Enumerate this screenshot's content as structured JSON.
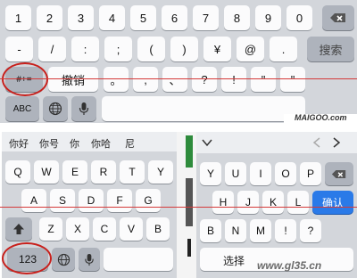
{
  "top": {
    "row1": [
      "1",
      "2",
      "3",
      "4",
      "5",
      "6",
      "7",
      "8",
      "9",
      "0"
    ],
    "row2": [
      "-",
      "/",
      ":",
      ";",
      "(",
      ")",
      "¥",
      "@",
      "."
    ],
    "search": "搜索",
    "row3_switch": "#+=",
    "undo": "撤销",
    "row3": [
      "。",
      ",",
      "、",
      "?",
      "!",
      "\"",
      "\""
    ],
    "abc": "ABC",
    "watermark": "MAIGOO.com"
  },
  "bottomLeft": {
    "candidates": [
      "你好",
      "你号",
      "你",
      "你哈",
      "尼"
    ],
    "row1": [
      "Q",
      "W",
      "E",
      "R",
      "T",
      "Y"
    ],
    "row2": [
      "A",
      "S",
      "D",
      "F",
      "G"
    ],
    "row3": [
      "Z",
      "X",
      "C",
      "V",
      "B"
    ],
    "num": "123"
  },
  "bottomRight": {
    "row1": [
      "Y",
      "U",
      "I",
      "O",
      "P"
    ],
    "row2": [
      "H",
      "J",
      "K",
      "L"
    ],
    "confirm": "确认",
    "row3": [
      "B",
      "N",
      "M",
      "!",
      "?"
    ],
    "space_partial": "选择",
    "watermark": "www.gl35.cn"
  },
  "colors": {
    "accent": "#2a7ae8",
    "annotation": "#c8201c"
  }
}
